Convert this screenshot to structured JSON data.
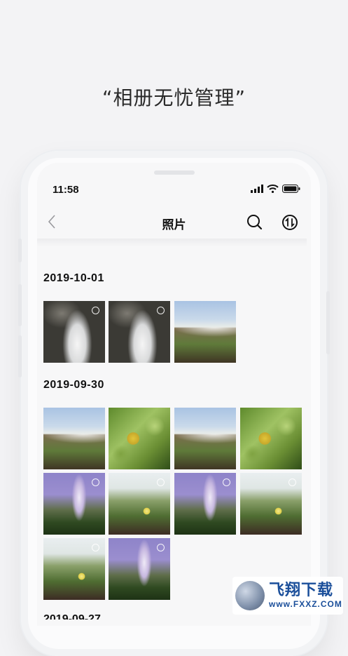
{
  "promo": {
    "headline": "“相册无忧管理”"
  },
  "status_bar": {
    "time": "11:58",
    "icons": [
      "signal-icon",
      "wifi-icon",
      "battery-icon"
    ]
  },
  "nav": {
    "back_icon": "chevron-left-icon",
    "title": "照片",
    "search_icon": "search-icon",
    "sort_icon": "sort-icon"
  },
  "groups": [
    {
      "date": "2019-10-01",
      "photos": [
        "waterfall-bw",
        "waterfall-bw",
        "waterfall-cliff"
      ]
    },
    {
      "date": "2019-09-30",
      "photos": [
        "waterfall-cliff",
        "leaves-yellow",
        "waterfall-cliff",
        "leaves-yellow",
        "waterfall-purple",
        "flower-field",
        "waterfall-purple",
        "flower-field",
        "flower-field",
        "waterfall-purple"
      ]
    },
    {
      "date": "2019-09-27",
      "photos": []
    }
  ],
  "watermark": {
    "main": "飞翔下载",
    "sub": "www.FXXZ.COM"
  },
  "colors": {
    "background": "#f3f3f5",
    "text": "#111111",
    "watermark": "#1a4e9a"
  }
}
